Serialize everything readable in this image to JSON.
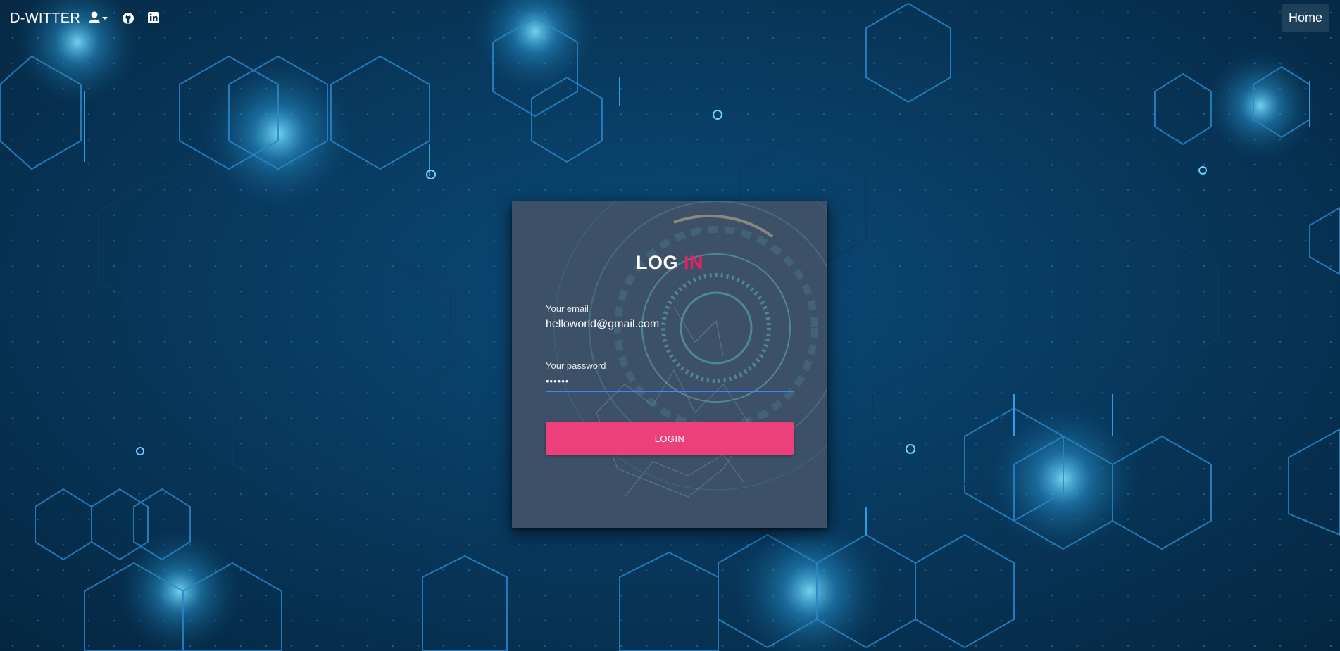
{
  "navbar": {
    "brand": "D-WITTER",
    "icons": [
      "user-dropdown-icon",
      "github-icon",
      "linkedin-icon"
    ],
    "home_label": "Home"
  },
  "login_card": {
    "title_part1": "LOG",
    "title_part2": "IN",
    "email": {
      "label": "Your email",
      "value": "helloworld@gmail.com"
    },
    "password": {
      "label": "Your password",
      "value": "••••••"
    },
    "button_label": "LOGIN"
  },
  "colors": {
    "accent": "#e91e63",
    "button": "#ec407a",
    "focus_line": "#4285f4",
    "card_bg": "#3c5068",
    "page_bg": "#083a60"
  }
}
